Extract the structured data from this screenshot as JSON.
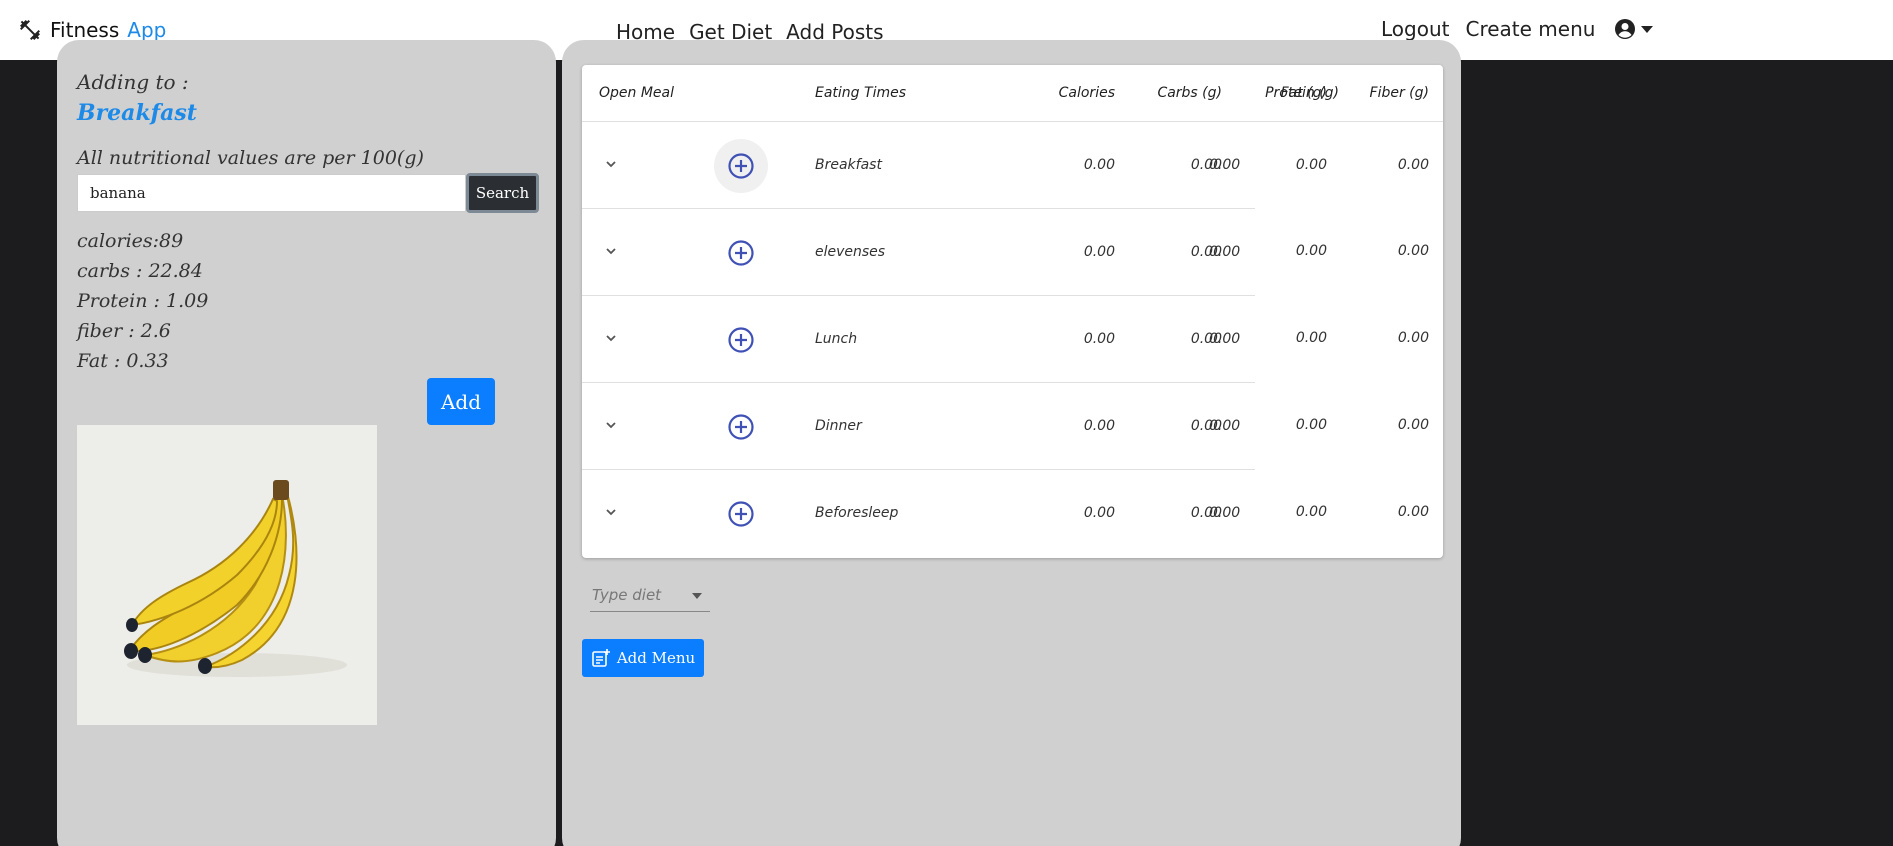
{
  "navbar": {
    "brand_first": "Fitness",
    "brand_second": "App",
    "links": [
      "Home",
      "Get Diet",
      "Add Posts"
    ],
    "logout": "Logout",
    "create_menu": "Create menu"
  },
  "left": {
    "adding_to": "Adding to :",
    "meal_name": "Breakfast",
    "per_note": "All nutritional values are per 100(g)",
    "search_value": "banana",
    "search_button": "Search",
    "nutrition": [
      "calories:89",
      "carbs : 22.84",
      "Protein : 1.09",
      "fiber : 2.6",
      "Fat : 0.33"
    ],
    "add_button": "Add"
  },
  "table": {
    "headers": [
      "Open Meal",
      "Eating Times",
      "Calories",
      "Carbs (g)",
      "Protein (g)",
      "Fat (g)",
      "Fiber (g)"
    ],
    "rows": [
      {
        "name": "Breakfast",
        "calories": "0.00",
        "carbs": "0.00",
        "protein": "0.00",
        "fat": "0.00",
        "fiber": "0.00"
      },
      {
        "name": "elevenses",
        "calories": "0.00",
        "carbs": "0.00",
        "protein": "0.00",
        "fat": "0.00",
        "fiber": "0.00"
      },
      {
        "name": "Lunch",
        "calories": "0.00",
        "carbs": "0.00",
        "protein": "0.00",
        "fat": "0.00",
        "fiber": "0.00"
      },
      {
        "name": "Dinner",
        "calories": "0.00",
        "carbs": "0.00",
        "protein": "0.00",
        "fat": "0.00",
        "fiber": "0.00"
      },
      {
        "name": "Beforesleep",
        "calories": "0.00",
        "carbs": "0.00",
        "protein": "0.00",
        "fat": "0.00",
        "fiber": "0.00"
      }
    ]
  },
  "type_diet_placeholder": "Type diet",
  "add_menu_button": "Add Menu",
  "colors": {
    "accent": "#1e8ae8",
    "button_primary": "#0b7dff",
    "plus_icon": "#3f51b5",
    "panel": "#d0d0d0",
    "background": "#1c1c1e"
  }
}
